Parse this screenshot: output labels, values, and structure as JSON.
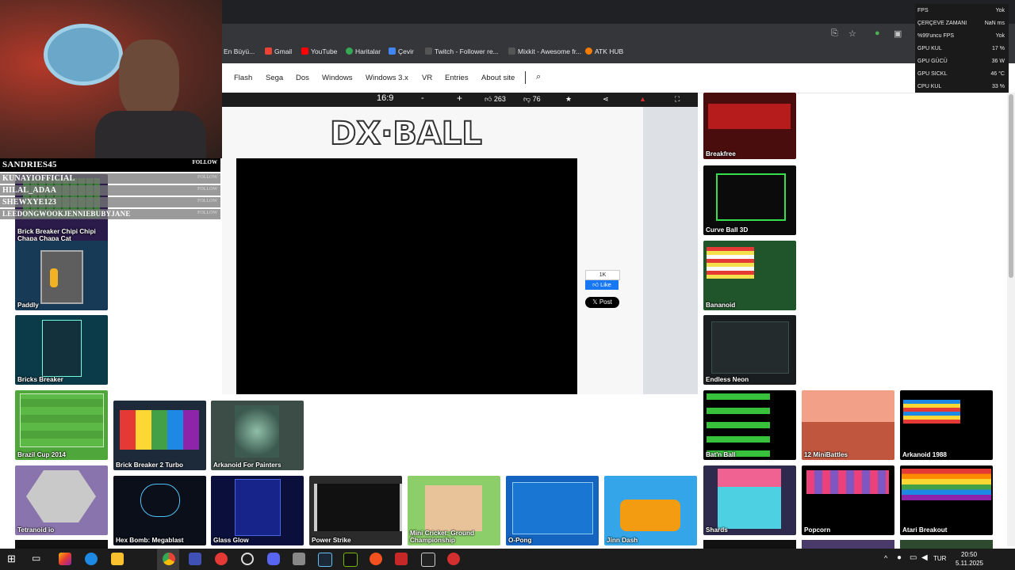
{
  "bookmarks": [
    {
      "label": "En Büyü...",
      "color": "#888888"
    },
    {
      "label": "Gmail",
      "color": "#ea4335"
    },
    {
      "label": "YouTube",
      "color": "#ff0000"
    },
    {
      "label": "Haritalar",
      "color": "#34a853"
    },
    {
      "label": "Çevir",
      "color": "#4285f4"
    },
    {
      "label": "Twitch - Follower re...",
      "color": "#333333"
    },
    {
      "label": "Mixkit - Awesome fr...",
      "color": "#333333"
    },
    {
      "label": "ATK HUB",
      "color": "#f57c00"
    }
  ],
  "nav": [
    "Flash",
    "Sega",
    "Dos",
    "Windows",
    "Windows 3.x",
    "VR",
    "Entries",
    "About site"
  ],
  "player": {
    "ratio": "16:9",
    "minus": "-",
    "plus": "+",
    "likes": "263",
    "dislikes": "76",
    "logo": "DX·BALL"
  },
  "social": {
    "fb_count": "1K",
    "fb_like": "Like",
    "x_post": "Post"
  },
  "tiles": [
    {
      "label": "Brick Breaker Chipi Chipi Chapa Chapa Cat"
    },
    {
      "label": "Paddly"
    },
    {
      "label": "Bricks Breaker"
    },
    {
      "label": "Brazil Cup 2014"
    },
    {
      "label": "Tetranoid io"
    },
    {
      "label": "Brick Breaker 2 Turbo"
    },
    {
      "label": "Arkanoid For Painters"
    },
    {
      "label": "Hex Bomb: Megablast"
    },
    {
      "label": "Glass Glow"
    },
    {
      "label": "Power Strike"
    },
    {
      "label": "Mini Cricket: Ground Championship"
    },
    {
      "label": "O-Pong"
    },
    {
      "label": "Jinn Dash"
    },
    {
      "label": "Breakfree"
    },
    {
      "label": "Curve Ball 3D"
    },
    {
      "label": "Bananoid"
    },
    {
      "label": "Endless Neon"
    },
    {
      "label": "Bat'n Ball"
    },
    {
      "label": "12 MiniBattles"
    },
    {
      "label": "Arkanoid 1988"
    },
    {
      "label": "Shards"
    },
    {
      "label": "Popcorn"
    },
    {
      "label": "Atari Breakout"
    }
  ],
  "stream": {
    "header_name": "SANDRIES45",
    "header_btn": "FOLLOW",
    "rows": [
      {
        "name": "KUNAYIOFFICIAL",
        "btn": "FOLLOW"
      },
      {
        "name": "HILAL_ADAA",
        "btn": "FOLLOW"
      },
      {
        "name": "SHEWXYE123",
        "btn": "FOLLOW"
      },
      {
        "name": "LEEDONGWOOKJENNIEBUBYJANE",
        "btn": "FOLLOW"
      }
    ]
  },
  "overlay": [
    {
      "k": "FPS",
      "v": "Yok"
    },
    {
      "k": "ÇERÇEVE ZAMANI",
      "v": "NaN ms"
    },
    {
      "k": "%99'uncu FPS",
      "v": "Yok"
    },
    {
      "k": "GPU KUL",
      "v": "17 %"
    },
    {
      "k": "GPU GÜCÜ",
      "v": "36 W"
    },
    {
      "k": "GPU SICKL",
      "v": "46 °C"
    },
    {
      "k": "CPU KUL",
      "v": "33 %"
    }
  ],
  "taskbar": {
    "lang": "TUR",
    "time": "20:50",
    "date": "5.11.2025"
  }
}
